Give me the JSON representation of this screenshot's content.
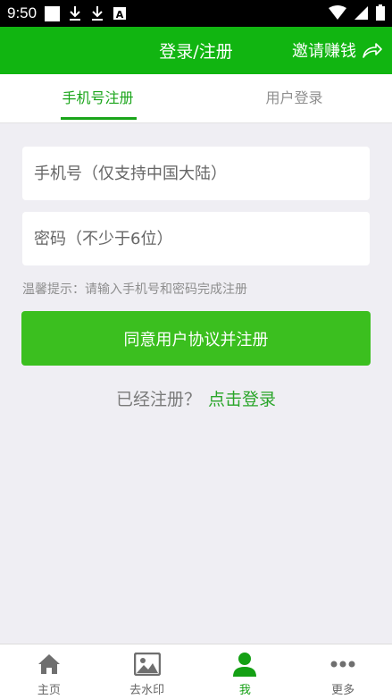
{
  "status_bar": {
    "time": "9:50",
    "icons": [
      "photo-icon",
      "download-icon",
      "download-icon",
      "font-icon",
      "wifi-icon",
      "signal-icon",
      "battery-icon"
    ]
  },
  "header": {
    "title": "登录/注册",
    "invite_label": "邀请赚钱",
    "invite_icon": "share-arrow-icon",
    "background": "#11b511"
  },
  "tabs": [
    {
      "label": "手机号注册",
      "active": true
    },
    {
      "label": "用户登录",
      "active": false
    }
  ],
  "form": {
    "phone_placeholder": "手机号（仅支持中国大陆）",
    "password_placeholder": "密码（不少于6位）",
    "hint": "温馨提示：请输入手机号和密码完成注册",
    "submit_label": "同意用户协议并注册",
    "submit_color": "#3bbf1f"
  },
  "login_prompt": {
    "text": "已经注册？",
    "link": "点击登录"
  },
  "bottom_nav": [
    {
      "label": "主页",
      "icon": "home-icon",
      "active": false
    },
    {
      "label": "去水印",
      "icon": "image-icon",
      "active": false
    },
    {
      "label": "我",
      "icon": "person-icon",
      "active": true
    },
    {
      "label": "更多",
      "icon": "more-dots-icon",
      "active": false
    }
  ]
}
